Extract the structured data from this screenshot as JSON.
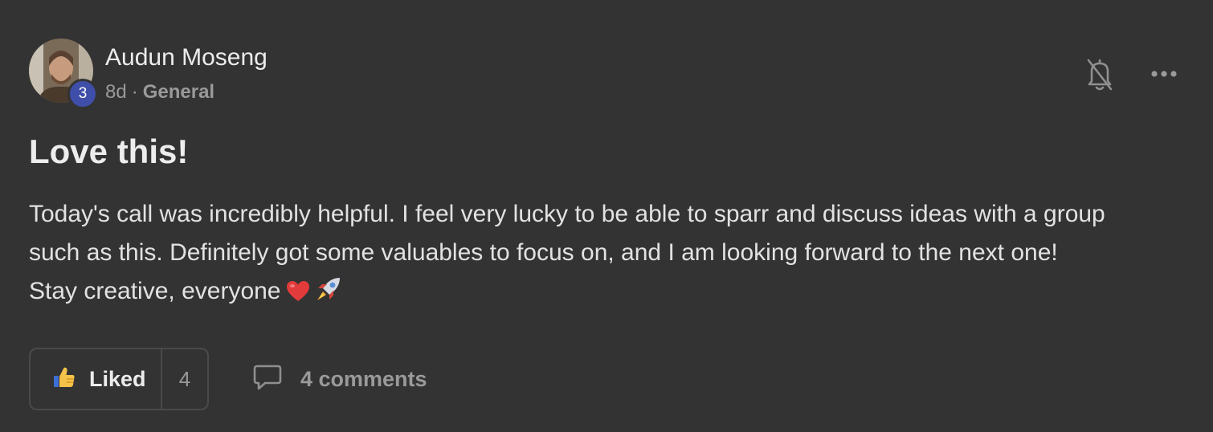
{
  "post": {
    "author": {
      "name": "Audun Moseng",
      "level": "3"
    },
    "meta": {
      "time": "8d",
      "separator": "·",
      "category": "General"
    },
    "title": "Love this!",
    "body_lines": [
      "Today's call was incredibly helpful. I feel very lucky to be able to sparr and discuss ideas with a group",
      "such as this. Definitely got some valuables to focus on, and I am looking forward to the next one!",
      "Stay creative, everyone"
    ],
    "body_emojis": [
      "red-heart-emoji",
      "rocket-emoji"
    ],
    "actions": {
      "like_label": "Liked",
      "like_count": "4",
      "comments_label": "4 comments"
    },
    "icons": {
      "notification": "bell-off-icon",
      "menu": "more-horizontal-icon",
      "like": "thumbs-up-icon",
      "comments": "comment-bubble-icon"
    }
  },
  "colors": {
    "background": "#333333",
    "level_badge": "#3f4ea8",
    "text_primary": "#ececec",
    "text_muted": "#9a9a9a"
  }
}
